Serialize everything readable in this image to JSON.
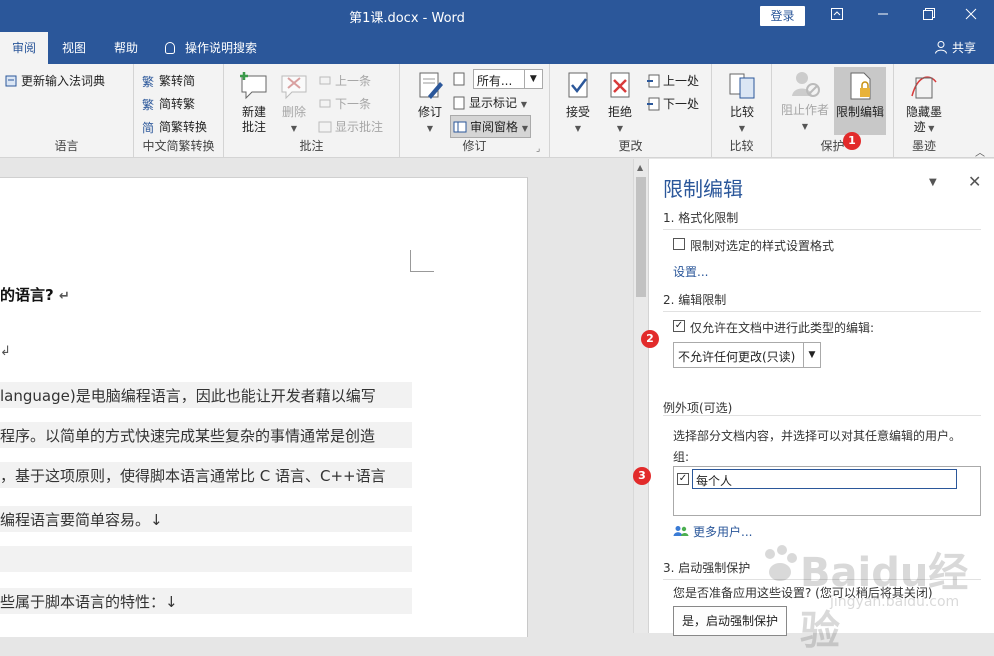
{
  "window": {
    "title": "第1课.docx  -  Word",
    "login_label": "登录",
    "share_label": "共享"
  },
  "tabs": [
    {
      "label": "审阅",
      "active": true
    },
    {
      "label": "视图"
    },
    {
      "label": "帮助"
    }
  ],
  "tell_me": "操作说明搜索",
  "ribbon": {
    "language": {
      "label": "语言",
      "update_ime": "更新输入法词典"
    },
    "chinese_conv": {
      "label": "中文简繁转换",
      "to_trad": "繁转简",
      "to_simp": "简转繁",
      "conv": "简繁转换"
    },
    "comments": {
      "label": "批注",
      "new": "新建\n批注",
      "delete": "删除",
      "prev": "上一条",
      "next": "下一条",
      "show": "显示批注"
    },
    "tracking": {
      "label": "修订",
      "track": "修订",
      "markup_select": "所有...",
      "show_markup": "显示标记",
      "pane": "审阅窗格"
    },
    "changes": {
      "label": "更改",
      "accept": "接受",
      "reject": "拒绝",
      "prev": "上一处",
      "next": "下一处"
    },
    "compare": {
      "label": "比较",
      "compare": "比较"
    },
    "protect": {
      "label": "保护",
      "block": "阻止作者",
      "restrict": "限制编辑"
    },
    "ink": {
      "label": "墨迹",
      "hide": "隐藏墨\n迹"
    }
  },
  "document": {
    "heading": "的语言?",
    "lines": [
      "language)是电脑编程语言，因此也能让开发者藉以编写",
      "程序。以简单的方式快速完成某些复杂的事情通常是创造",
      "，基于这项原则，使得脚本语言通常比 C 语言、C++语言",
      "编程语言要简单容易。↓",
      "",
      "些属于脚本语言的特性：↓"
    ]
  },
  "pane": {
    "title": "限制编辑",
    "sec1": "1. 格式化限制",
    "sec1_check": "限制对选定的样式设置格式",
    "sec1_link": "设置...",
    "sec2": "2. 编辑限制",
    "sec2_check": "仅允许在文档中进行此类型的编辑:",
    "edit_type": "不允许任何更改(只读)",
    "exceptions_title": "例外项(可选)",
    "exceptions_desc": "选择部分文档内容，并选择可以对其任意编辑的用户。",
    "groups_label": "组:",
    "group_name": "每个人",
    "more_users": "更多用户...",
    "sec3": "3. 启动强制保护",
    "sec3_desc": "您是否准备应用这些设置? (您可以稍后将其关闭)",
    "enforce_btn": "是，启动强制保护"
  },
  "badges": [
    "1",
    "2",
    "3"
  ],
  "watermark": {
    "text": "Baidu经验",
    "sub": "jingyan.baidu.com"
  },
  "colors": {
    "brand": "#2b579a",
    "badge": "#e22b2b"
  }
}
